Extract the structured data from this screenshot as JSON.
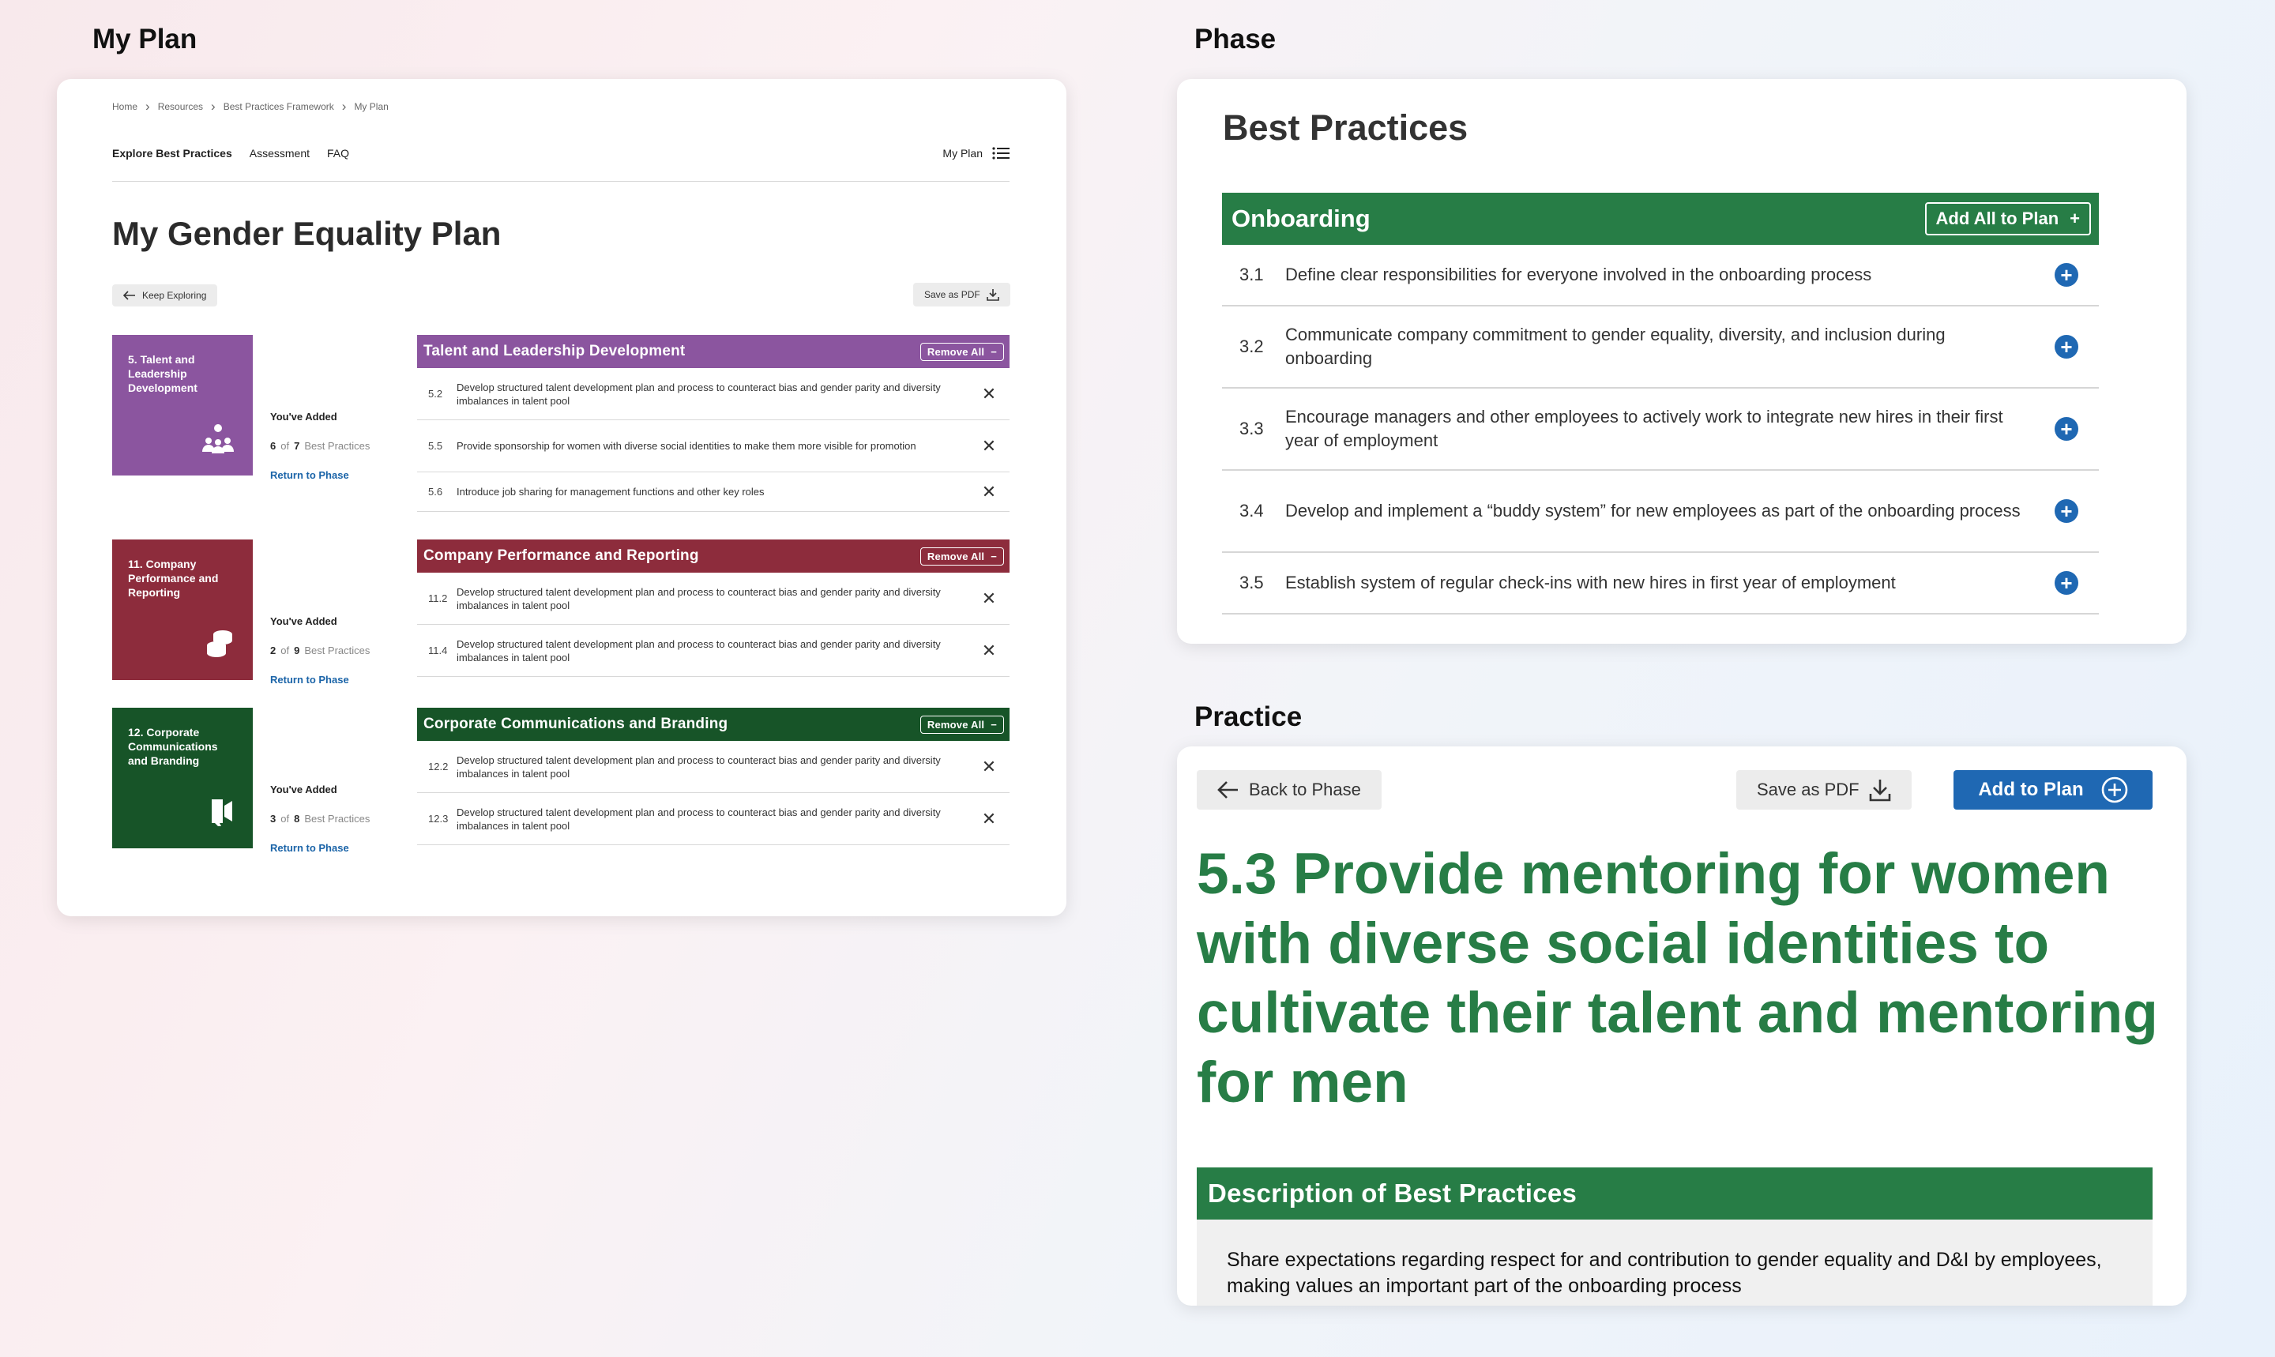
{
  "sections": {
    "my_plan": "My Plan",
    "phase": "Phase",
    "practice": "Practice"
  },
  "my_plan": {
    "breadcrumb": [
      "Home",
      "Resources",
      "Best Practices Framework",
      "My Plan"
    ],
    "nav": {
      "items": [
        "Explore Best Practices",
        "Assessment",
        "FAQ"
      ],
      "my_plan": "My Plan"
    },
    "title": "My Gender Equality Plan",
    "keep_exploring": "Keep Exploring",
    "save_pdf": "Save as PDF",
    "groups": [
      {
        "tile": "5. Talent and Leadership Development",
        "color": "#8b559f",
        "icon": "people-network-icon",
        "added_label": "You've Added",
        "added": "6",
        "of": "of",
        "total": "7",
        "unit": "Best Practices",
        "return": "Return to Phase",
        "bar": "Talent and Leadership Development",
        "remove": "Remove All",
        "practices": [
          {
            "num": "5.2",
            "text": "Develop structured talent development plan and process to counteract bias and gender parity and diversity imbalances in talent pool"
          },
          {
            "num": "5.5",
            "text": "Provide sponsorship for women with diverse social identities to make them more visible for promotion"
          },
          {
            "num": "5.6",
            "text": "Introduce job sharing for management functions and other key roles"
          }
        ]
      },
      {
        "tile": "11. Company Performance and Reporting",
        "color": "#8d2c3c",
        "icon": "coins-icon",
        "added_label": "You've Added",
        "added": "2",
        "of": "of",
        "total": "9",
        "unit": "Best Practices",
        "return": "Return to Phase",
        "bar": "Company Performance and Reporting",
        "remove": "Remove All",
        "practices": [
          {
            "num": "11.2",
            "text": "Develop structured talent development plan and process to counteract bias and gender parity and diversity imbalances in talent pool"
          },
          {
            "num": "11.4",
            "text": "Develop structured talent development plan and process to counteract bias and gender parity and diversity imbalances in talent pool"
          }
        ]
      },
      {
        "tile": "12. Corporate Communications and Branding",
        "color": "#175428",
        "icon": "megaphone-icon",
        "added_label": "You've Added",
        "added": "3",
        "of": "of",
        "total": "8",
        "unit": "Best Practices",
        "return": "Return to Phase",
        "bar": "Corporate Communications and Branding",
        "remove": "Remove All",
        "practices": [
          {
            "num": "12.2",
            "text": "Develop structured talent development plan and process to counteract bias and gender parity and diversity imbalances in talent pool"
          },
          {
            "num": "12.3",
            "text": "Develop structured talent development plan and process to counteract bias and gender parity and diversity imbalances in talent pool"
          }
        ]
      }
    ]
  },
  "phase": {
    "title": "Best Practices",
    "category": "Onboarding",
    "add_all": "Add All to Plan",
    "practices": [
      {
        "num": "3.1",
        "text": "Define clear responsibilities for everyone involved in the onboarding process"
      },
      {
        "num": "3.2",
        "text": "Communicate company commitment to gender equality, diversity, and inclusion during onboarding"
      },
      {
        "num": "3.3",
        "text": "Encourage managers and other employees to actively work to integrate new hires in their first year of employment"
      },
      {
        "num": "3.4",
        "text": "Develop and implement a “buddy system” for new employees as part of the onboarding process"
      },
      {
        "num": "3.5",
        "text": "Establish system of regular check-ins with new hires in first year of employment"
      }
    ]
  },
  "practice": {
    "back": "Back to Phase",
    "save_pdf": "Save as PDF",
    "add": "Add to Plan",
    "title": "5.3 Provide mentoring for women with diverse social identities to cultivate their talent and mentoring for men",
    "desc_heading": "Description of Best Practices",
    "desc_body": "Share expectations regarding respect for and contribution to gender equality and D&I by employees, making values an important part of the onboarding process"
  }
}
